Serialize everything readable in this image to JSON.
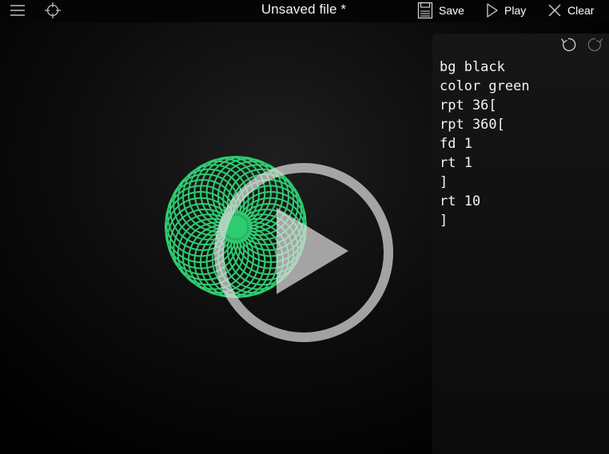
{
  "topbar": {
    "title": "Unsaved file *",
    "save_label": "Save",
    "play_label": "Play",
    "clear_label": "Clear",
    "menu_icon": "hamburger-menu-icon",
    "target_icon": "crosshair-target-icon"
  },
  "editor": {
    "lines": [
      "bg black",
      "color green",
      "rpt 36[",
      "rpt 360[",
      "fd 1",
      "rt 1",
      "]",
      "rt 10",
      "]"
    ]
  },
  "canvas": {
    "background": "#000000",
    "pen_color": "#2ecc71",
    "overlay_icon": "play-circle-icon"
  },
  "colors": {
    "accent_green": "#2ecc71",
    "overlay": "#e0e0e0"
  }
}
